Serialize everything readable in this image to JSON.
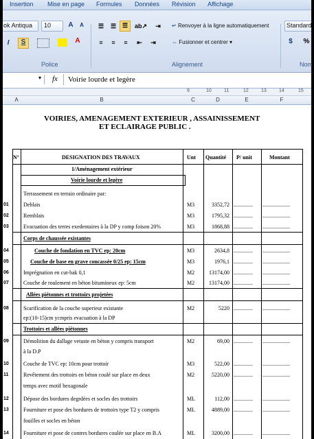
{
  "menu": [
    "Insertion",
    "Mise en page",
    "Formules",
    "Données",
    "Révision",
    "Affichage"
  ],
  "toolbar": {
    "font_name": "ok Antiqua",
    "font_size": "10",
    "wrap_text": "Renvoyer à la ligne automatiquement",
    "merge_center": "Fusionner et centrer",
    "number_format": "Standard",
    "percent": "%",
    "group_police": "Police",
    "group_alignement": "Alignement",
    "group_nombre": "Nomb",
    "grow": "A",
    "bold_s": "S",
    "italic_i": "I"
  },
  "formula": {
    "fx": "fx",
    "content": "Voirie lourde et legère",
    "namebox": ""
  },
  "ruler": [
    "9",
    "10",
    "11",
    "12",
    "13",
    "14",
    "15"
  ],
  "columns": [
    "A",
    "B",
    "C",
    "D",
    "E",
    "F"
  ],
  "doc": {
    "title1": "VOIRIES, AMENAGEMENT EXTERIEUR , ASSAINISSEMENT",
    "title2": "ET ECLAIRAGE PUBLIC .",
    "headers": {
      "n": "N°",
      "designation": "DESIGNATION DES TRAVAUX",
      "unit": "Unt",
      "qty": "Quantité",
      "pu": "P/ unit",
      "montant": "Montant"
    },
    "section1": "1/Aménagement extérieur",
    "subsection": "Voirie lourde et legère",
    "terrassement": "Terrassement en terrain ordinaire par:",
    "rows": [
      {
        "n": "01",
        "d": "Deblais",
        "u": "M3",
        "q": "3352,72",
        "p": "..............",
        "m": "...................."
      },
      {
        "n": "02",
        "d": "Remblais",
        "u": "M3",
        "q": "1795,32",
        "p": "..............",
        "m": "...................."
      },
      {
        "n": "03",
        "d": "Evacuation des terres exedentaires à la DP y comp foison 20%",
        "u": "M3",
        "q": "1868,88",
        "p": "..............",
        "m": "...................."
      },
      {
        "n": "04",
        "d": "Couche de fondation en TVC  ep: 20cm",
        "u": "M3",
        "q": "2634,8",
        "p": "..............",
        "m": "...................."
      },
      {
        "n": "05",
        "d": "Couche de base en grave concassée 0/25 ep: 15cm",
        "u": "M3",
        "q": "1976,1",
        "p": "..............",
        "m": "...................."
      },
      {
        "n": "06",
        "d": "Imprégnation en cut-bak 0,1",
        "u": "M2",
        "q": "13174,00",
        "p": "..............",
        "m": "...................."
      },
      {
        "n": "07",
        "d": "Couche de roulement en béton bitumineux ep: 5cm",
        "u": "M2",
        "q": "13174,00",
        "p": "..............",
        "m": "...................."
      },
      {
        "n": "08",
        "d": "Scarification de la couche superieur  existante",
        "d2": "ep:(10-15)cm  ycmpris evacuation à la DP",
        "u": "M2",
        "q": "5220",
        "p": "..............",
        "m": "...................."
      },
      {
        "n": "09",
        "d": "Démolition du dallage vetuste en béton y compris transport",
        "d2": "à la D.P",
        "u": "M2",
        "q": "69,00",
        "p": "..............",
        "m": "...................."
      },
      {
        "n": "10",
        "d": "Couche de TVC  ep: 10cm pour trottoir",
        "u": "M3",
        "q": "522,00",
        "p": "..............",
        "m": "...................."
      },
      {
        "n": "11",
        "d": "Revêtement des trottoirs en béton coulé sur place en deux",
        "d2": "temps avec motif hexagonale",
        "u": "M2",
        "q": "5220,00",
        "p": "..............",
        "m": "...................."
      },
      {
        "n": "12",
        "d": "Dépose des bordures degrdées et socles des trottoirs",
        "u": "ML",
        "q": "112,00",
        "p": "..............",
        "m": "...................."
      },
      {
        "n": "13",
        "d": "Fourniture et pose des bordures de trottoirs type T2 y compris",
        "d2": "fouilles et socles en béton",
        "u": "ML",
        "q": "4889,00",
        "p": "..............",
        "m": "...................."
      },
      {
        "n": "14",
        "d": "Fourniture et pose de contres bordures coulée sur place en B.A",
        "u": "ML",
        "q": "3200,00",
        "p": "..............",
        "m": "...................."
      }
    ],
    "corps": "Corps de chaussée existantes",
    "allees": "Allées piétonnes et trottoirs projetées",
    "trottoirs": "Trottoirs et allées piétonnes"
  }
}
